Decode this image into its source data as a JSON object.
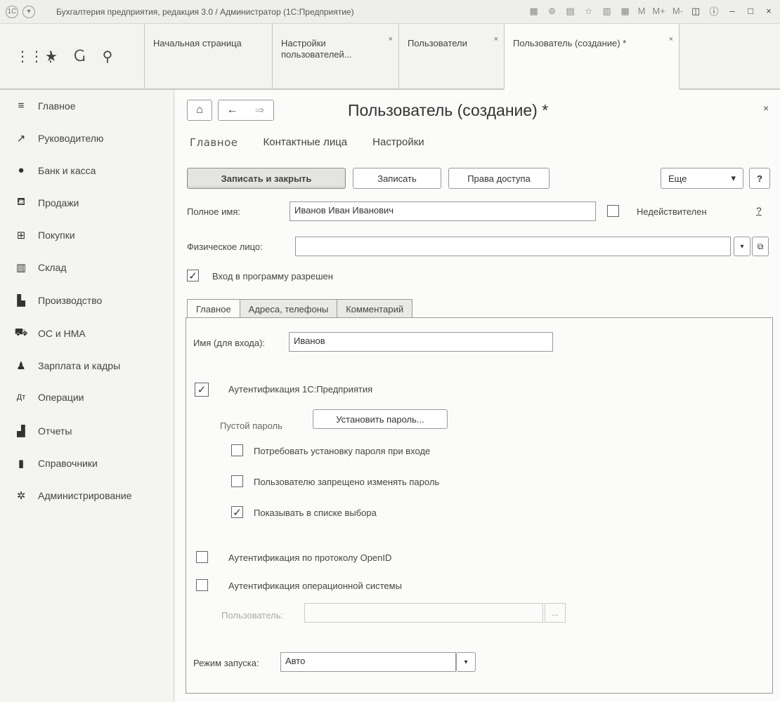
{
  "window": {
    "title": "Бухгалтерия предприятия, редакция 3.0 / Администратор  (1С:Предприятие)"
  },
  "tabs": [
    {
      "label": "Начальная страница"
    },
    {
      "label": "Настройки пользователей...",
      "close": "×"
    },
    {
      "label": "Пользователи",
      "close": "×"
    },
    {
      "label": "Пользователь (создание) *",
      "close": "×"
    }
  ],
  "sidebar": {
    "items": [
      {
        "label": "Главное",
        "icon": "menu-icon"
      },
      {
        "label": "Руководителю",
        "icon": "chart-line-icon"
      },
      {
        "label": "Банк и касса",
        "icon": "coin-icon"
      },
      {
        "label": "Продажи",
        "icon": "bag-icon"
      },
      {
        "label": "Покупки",
        "icon": "cart-icon"
      },
      {
        "label": "Склад",
        "icon": "warehouse-icon"
      },
      {
        "label": "Производство",
        "icon": "factory-icon"
      },
      {
        "label": "ОС и НМА",
        "icon": "truck-icon"
      },
      {
        "label": "Зарплата и кадры",
        "icon": "person-icon"
      },
      {
        "label": "Операции",
        "icon": "operations-icon"
      },
      {
        "label": "Отчеты",
        "icon": "bar-chart-icon"
      },
      {
        "label": "Справочники",
        "icon": "book-icon"
      },
      {
        "label": "Администрирование",
        "icon": "gear-icon"
      }
    ]
  },
  "form": {
    "title": "Пользователь (создание) *",
    "close": "×",
    "subtabs": [
      "Главное",
      "Контактные лица",
      "Настройки"
    ],
    "toolbar": {
      "save_close": "Записать и закрыть",
      "save": "Записать",
      "access": "Права доступа",
      "more": "Еще",
      "more_arrow": "▾",
      "help": "?"
    },
    "full_name_label": "Полное имя:",
    "full_name_value": "Иванов Иван Иванович",
    "invalid_label": "Недействителен",
    "invalid_help": "?",
    "person_label": "Физическое лицо:",
    "person_value": "",
    "login_allowed_label": "Вход в программу разрешен",
    "login_allowed_checked": true,
    "inner_tabs": [
      "Главное",
      "Адреса, телефоны",
      "Комментарий"
    ],
    "login_name_label": "Имя (для входа):",
    "login_name_value": "Иванов",
    "auth_1c_label": "Аутентификация 1С:Предприятия",
    "auth_1c_checked": true,
    "empty_password_label": "Пустой пароль",
    "set_password_button": "Установить пароль...",
    "require_password_label": "Потребовать установку пароля при входе",
    "forbid_change_label": "Пользователю запрещено изменять пароль",
    "show_in_list_label": "Показывать в списке выбора",
    "show_in_list_checked": true,
    "openid_label": "Аутентификация по протоколу OpenID",
    "os_auth_label": "Аутентификация операционной системы",
    "os_user_label": "Пользователь:",
    "os_user_dots": "...",
    "launch_mode_label": "Режим запуска:",
    "launch_mode_value": "Авто",
    "check_mark": "✓"
  }
}
